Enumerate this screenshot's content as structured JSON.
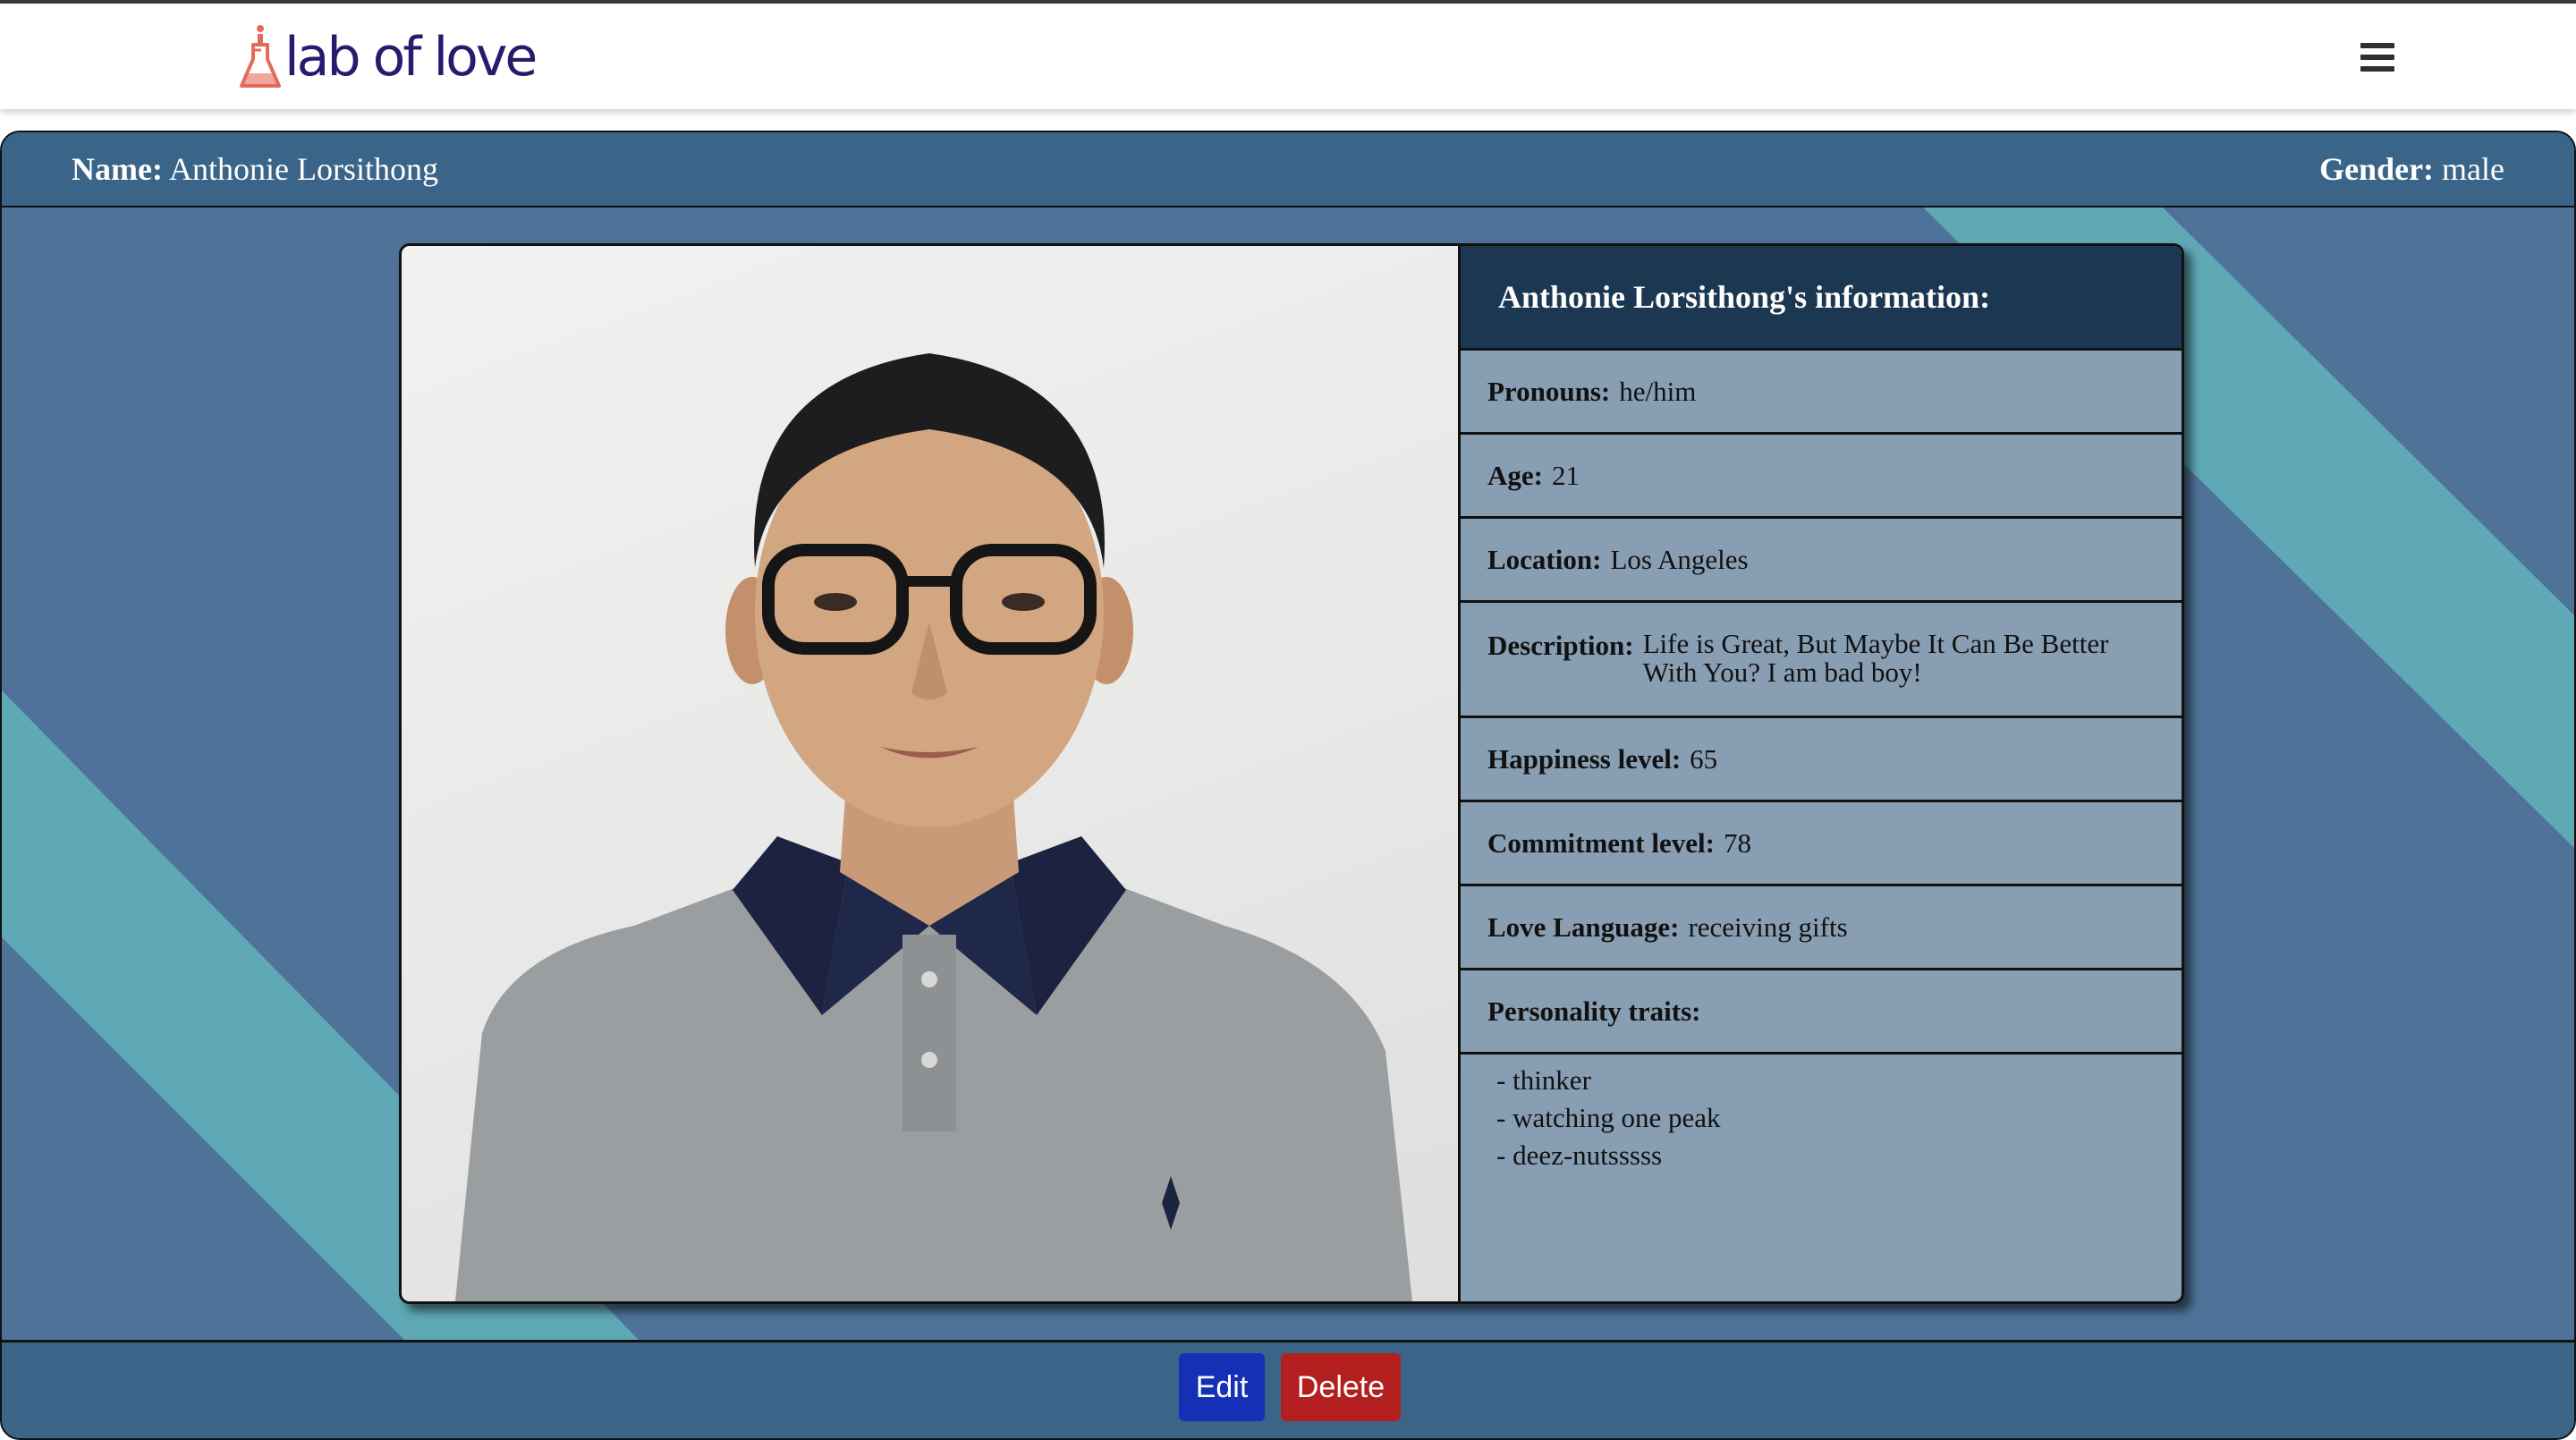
{
  "nav": {
    "logo_text": "lab of love",
    "menu_icon": "hamburger-icon"
  },
  "profile": {
    "name_label": "Name:",
    "name": "Anthonie Lorsithong",
    "gender_label": "Gender:",
    "gender": "male",
    "info_title": "Anthonie Lorsithong's information:",
    "fields": [
      {
        "label": "Pronouns:",
        "value": "he/him"
      },
      {
        "label": "Age:",
        "value": "21"
      },
      {
        "label": "Location:",
        "value": "Los Angeles"
      },
      {
        "label": "Description:",
        "value": "Life is Great, But Maybe It Can Be Better With You? I am bad boy!"
      },
      {
        "label": "Happiness level:",
        "value": "65"
      },
      {
        "label": "Commitment level:",
        "value": "78"
      },
      {
        "label": "Love Language:",
        "value": "receiving gifts"
      },
      {
        "label": "Personality traits:",
        "value": ""
      }
    ],
    "traits": [
      "thinker",
      "watching one peak",
      "deez-nutsssss"
    ]
  },
  "actions": {
    "edit_label": "Edit",
    "delete_label": "Delete"
  },
  "colors": {
    "page_bg": "#4f7398",
    "stripe": "#5fa8b5",
    "bar": "#3a6589",
    "card_head": "#1c3752",
    "card_body": "#889eb3",
    "edit": "#1530b5",
    "delete": "#b31f1f"
  }
}
